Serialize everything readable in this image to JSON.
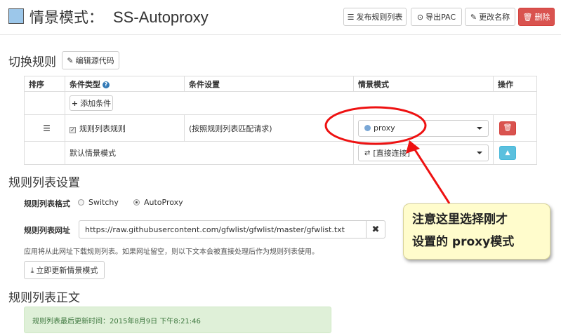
{
  "header": {
    "title_label": "情景模式：",
    "profile_name": "SS-Autoproxy",
    "actions": {
      "publish": "发布规则列表",
      "export_pac": "导出PAC",
      "rename": "更改名称",
      "delete": "删除"
    }
  },
  "switch_rules": {
    "heading": "切换规则",
    "edit_source": "编辑源代码",
    "columns": [
      "排序",
      "条件类型",
      "条件设置",
      "情景模式",
      "操作"
    ],
    "add_condition": "添加条件",
    "rule_row": {
      "condition_type": "规则列表规则",
      "condition_setting": "(按照规则列表匹配请求)",
      "profile": "proxy"
    },
    "default_row": {
      "label": "默认情景模式",
      "profile": "[直接连接]"
    }
  },
  "rule_list_settings": {
    "heading": "规则列表设置",
    "format_label": "规则列表格式",
    "format_options": [
      "Switchy",
      "AutoProxy"
    ],
    "format_selected": "AutoProxy",
    "url_label": "规则列表网址",
    "url_value": "https://raw.githubusercontent.com/gfwlist/gfwlist/master/gfwlist.txt",
    "hint": "应用将从此网址下载规则列表。如果网址留空，则以下文本会被直接处理后作为规则列表使用。",
    "update_button": "立即更新情景模式"
  },
  "rule_list_body": {
    "heading": "规则列表正文",
    "last_updated": "规则列表最后更新时间：2015年8月9日 下午8:21:46"
  },
  "annotation": {
    "line1": "注意这里选择刚才",
    "line2": "设置的 proxy模式"
  },
  "colors": {
    "danger": "#d9534f",
    "info": "#5bc0de",
    "annotation_red": "#ee1111",
    "callout_bg": "#fffccc"
  }
}
